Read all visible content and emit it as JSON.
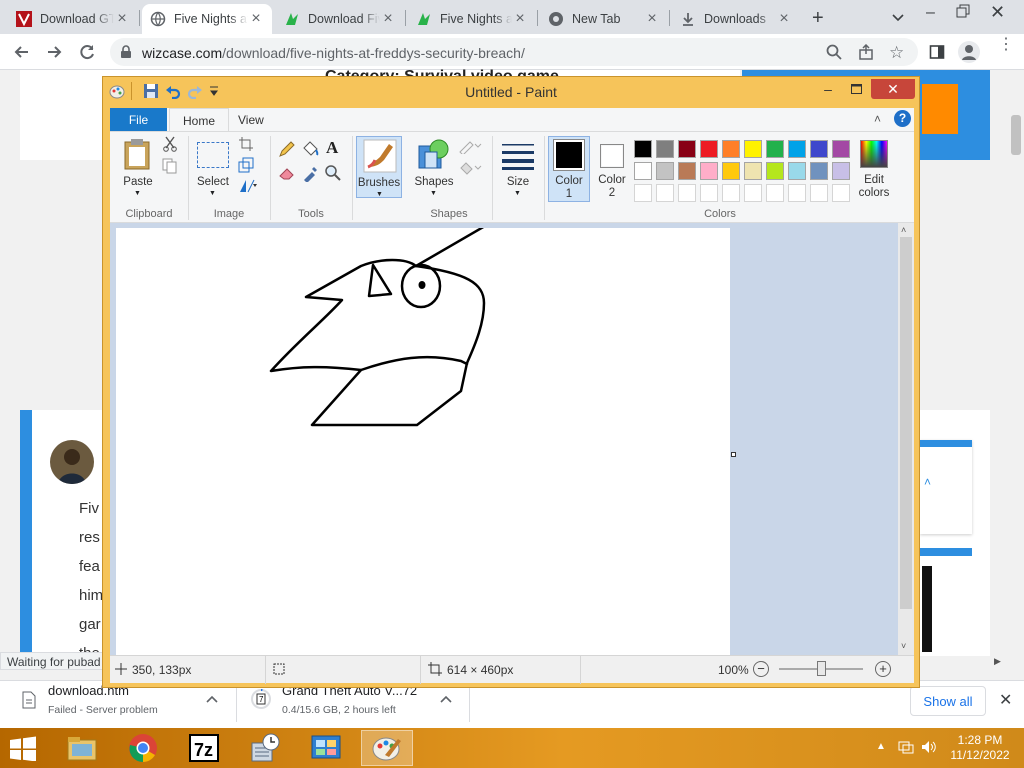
{
  "browser": {
    "tabs": [
      {
        "title": "Download GTA V",
        "icon": "red-v-icon",
        "active": false
      },
      {
        "title": "Five Nights at Freddy's",
        "icon": "globe-icon",
        "active": true
      },
      {
        "title": "Download Five Nights",
        "icon": "green-bird-icon",
        "active": false
      },
      {
        "title": "Five Nights at Freddy's",
        "icon": "green-bird-icon",
        "active": false
      },
      {
        "title": "New Tab",
        "icon": "chrome-icon",
        "active": false
      },
      {
        "title": "Downloads",
        "icon": "download-icon",
        "active": false
      }
    ],
    "url_host": "wizcase.com",
    "url_path": "/download/five-nights-at-freddys-security-breach/",
    "page_heading": "Category: Survival video game",
    "status_text": "Waiting for pubad",
    "article_lines": [
      "Fiv",
      "res",
      "fea",
      "him",
      "gar",
      "the"
    ]
  },
  "downloads": {
    "items": [
      {
        "name": "download.htm",
        "status": "Failed - Server problem",
        "icon": "file-icon"
      },
      {
        "name": "Grand Theft Auto V...72",
        "status": "0.4/15.6 GB, 2 hours left",
        "icon": "download-progress-icon",
        "progress": 0.026
      }
    ],
    "show_all": "Show all"
  },
  "paint": {
    "title": "Untitled - Paint",
    "tabs": {
      "file": "File",
      "home": "Home",
      "view": "View"
    },
    "groups": {
      "clipboard": "Clipboard",
      "image": "Image",
      "tools": "Tools",
      "shapes": "Shapes",
      "colors": "Colors"
    },
    "buttons": {
      "paste": "Paste",
      "select": "Select",
      "brushes": "Brushes",
      "shapes": "Shapes",
      "size": "Size",
      "color1": "Color",
      "color1_num": "1",
      "color2": "Color",
      "color2_num": "2",
      "edit_colors": "Edit",
      "edit_colors2": "colors"
    },
    "palette_row1": [
      "#000000",
      "#7f7f7f",
      "#880015",
      "#ed1c24",
      "#ff7f27",
      "#fff200",
      "#22b14c",
      "#00a2e8",
      "#3f48cc",
      "#a349a4"
    ],
    "palette_row2": [
      "#ffffff",
      "#c3c3c3",
      "#b97a57",
      "#ffaec9",
      "#ffc90e",
      "#efe4b0",
      "#b5e61d",
      "#99d9ea",
      "#7092be",
      "#c8bfe7"
    ],
    "color1_value": "#000000",
    "color2_value": "#ffffff",
    "status": {
      "cursor": "350, 133px",
      "size": "614 × 460px",
      "zoom": "100%",
      "zoom_level": 1.0
    }
  },
  "taskbar": {
    "time": "1:28 PM",
    "date": "11/12/2022",
    "apps": [
      "file-explorer-icon",
      "chrome-icon",
      "7zip-icon",
      "clock-app-icon",
      "control-panel-icon",
      "paint-icon"
    ]
  }
}
